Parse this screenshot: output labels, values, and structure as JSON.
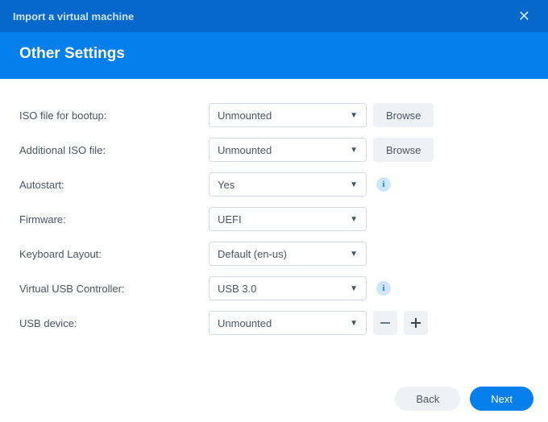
{
  "window": {
    "title": "Import a virtual machine"
  },
  "header": {
    "title": "Other Settings"
  },
  "fields": {
    "iso_bootup": {
      "label": "ISO file for bootup:",
      "value": "Unmounted",
      "browse": "Browse"
    },
    "iso_additional": {
      "label": "Additional ISO file:",
      "value": "Unmounted",
      "browse": "Browse"
    },
    "autostart": {
      "label": "Autostart:",
      "value": "Yes"
    },
    "firmware": {
      "label": "Firmware:",
      "value": "UEFI"
    },
    "keyboard": {
      "label": "Keyboard Layout:",
      "value": "Default (en-us)"
    },
    "usb_controller": {
      "label": "Virtual USB Controller:",
      "value": "USB 3.0"
    },
    "usb_device": {
      "label": "USB device:",
      "value": "Unmounted"
    }
  },
  "footer": {
    "back": "Back",
    "next": "Next"
  }
}
